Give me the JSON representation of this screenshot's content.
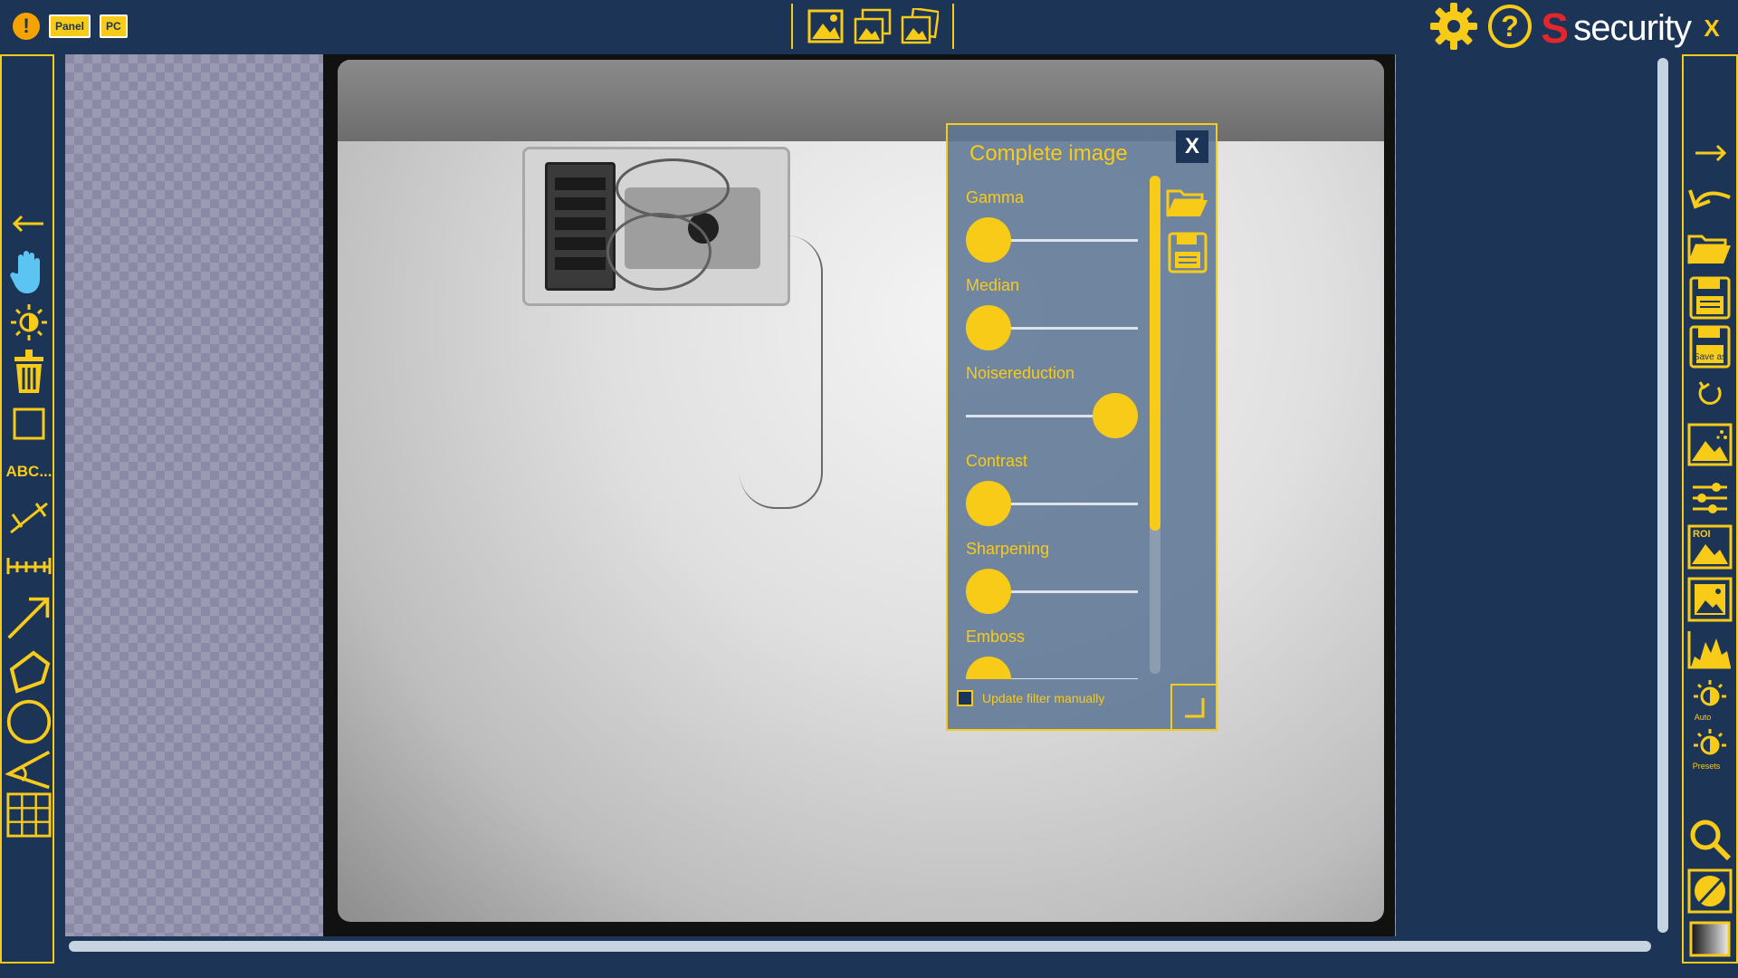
{
  "topbar": {
    "badges": [
      "Panel",
      "PC"
    ],
    "warning_glyph": "!",
    "image_tabs": [
      "single-image-icon",
      "multi-image-icon",
      "compare-image-icon"
    ],
    "brand": {
      "letter": "S",
      "text": "security"
    },
    "close_label": "X"
  },
  "left_toolbar": {
    "items": [
      {
        "name": "back-arrow-icon"
      },
      {
        "name": "pan-hand-icon"
      },
      {
        "name": "brightness-icon"
      },
      {
        "name": "delete-trash-icon"
      },
      {
        "name": "rectangle-select-icon"
      },
      {
        "name": "text-annotation",
        "label": "ABC..."
      },
      {
        "name": "line-measure-icon"
      },
      {
        "name": "ruler-icon"
      },
      {
        "name": "arrow-draw-icon"
      },
      {
        "name": "polygon-draw-icon"
      },
      {
        "name": "circle-draw-icon"
      },
      {
        "name": "angle-draw-icon"
      },
      {
        "name": "grid-icon"
      }
    ]
  },
  "right_toolbar": {
    "items": [
      {
        "name": "forward-arrow-icon"
      },
      {
        "name": "undo-icon"
      },
      {
        "name": "open-folder-icon"
      },
      {
        "name": "save-icon"
      },
      {
        "name": "save-as-icon",
        "label": "Save as"
      },
      {
        "name": "refresh-icon"
      },
      {
        "name": "image-filter-icon"
      },
      {
        "name": "adjust-sliders-icon"
      },
      {
        "name": "roi-filter-icon",
        "label": "ROI"
      },
      {
        "name": "image-frame-icon"
      },
      {
        "name": "histogram-icon"
      },
      {
        "name": "auto-brightness-icon",
        "label": "Auto"
      },
      {
        "name": "presets-brightness-icon",
        "label": "Presets"
      },
      {
        "name": "zoom-icon"
      },
      {
        "name": "invert-icon"
      },
      {
        "name": "gradient-icon"
      }
    ]
  },
  "filter_panel": {
    "title": "Complete image",
    "close_label": "X",
    "sliders": [
      {
        "label": "Gamma",
        "value": 0.0
      },
      {
        "label": "Median",
        "value": 0.0
      },
      {
        "label": "Noisereduction",
        "value": 1.0
      },
      {
        "label": "Contrast",
        "value": 0.0
      },
      {
        "label": "Sharpening",
        "value": 0.0
      },
      {
        "label": "Emboss",
        "value": 0.0
      }
    ],
    "scroll_position": 0.0,
    "update_manually_label": "Update filter manually",
    "update_manually_checked": false
  },
  "colors": {
    "background": "#1c3557",
    "accent": "#f8cb19",
    "brand_red": "#e3262c"
  }
}
